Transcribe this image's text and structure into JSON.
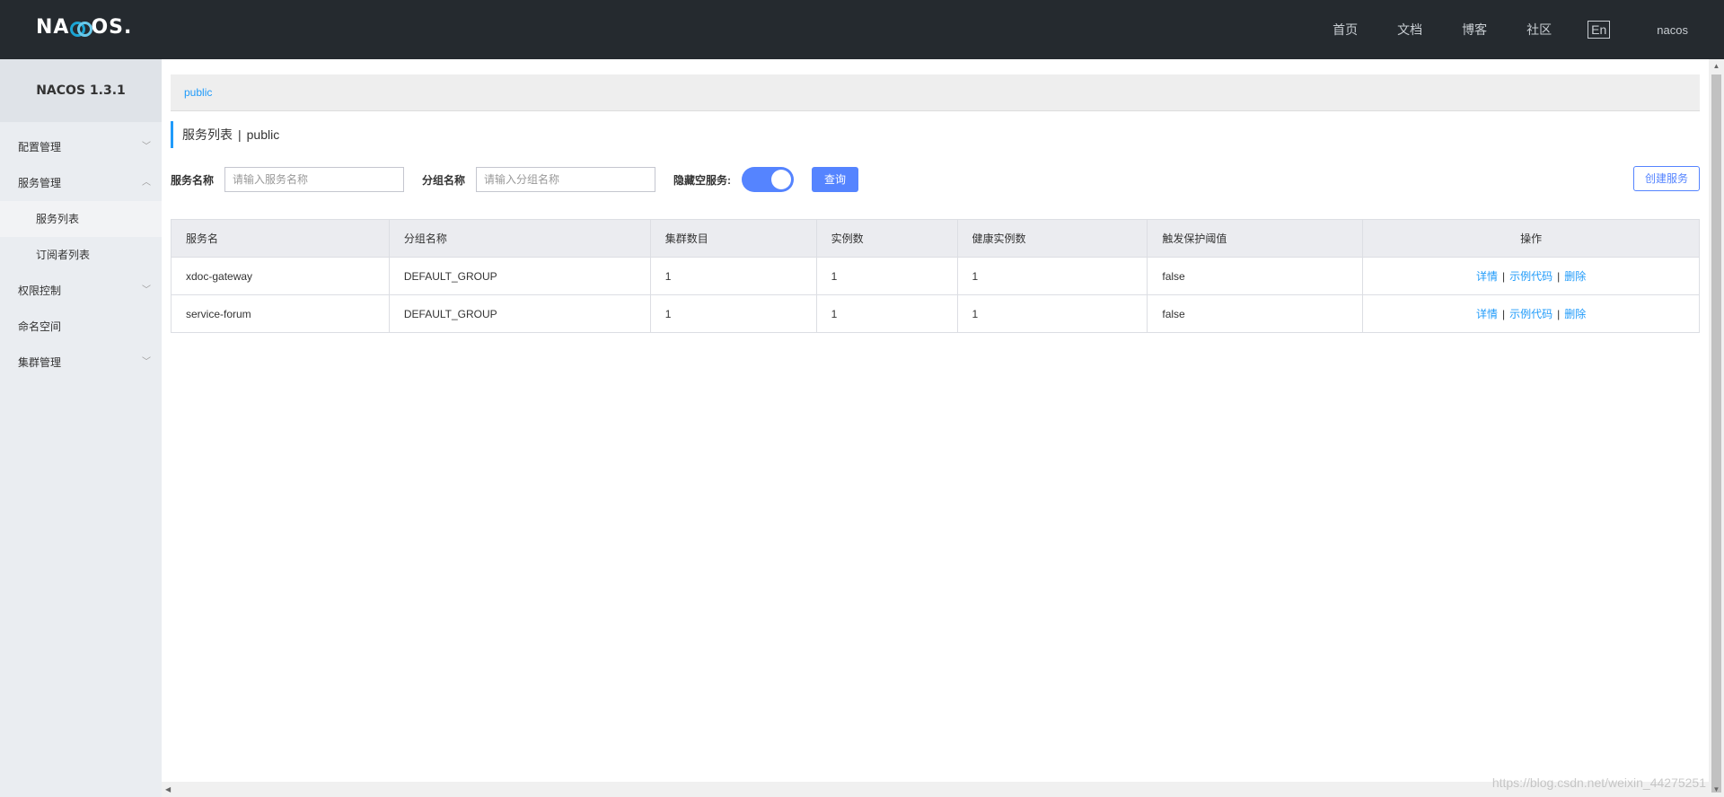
{
  "header": {
    "logo_text": "NACOS.",
    "nav": [
      "首页",
      "文档",
      "博客",
      "社区"
    ],
    "lang": "En",
    "user": "nacos"
  },
  "sidebar": {
    "version": "NACOS 1.3.1",
    "items": [
      {
        "label": "配置管理",
        "arrow": "﹀"
      },
      {
        "label": "服务管理",
        "arrow": "︿"
      },
      {
        "label": "服务列表"
      },
      {
        "label": "订阅者列表"
      },
      {
        "label": "权限控制",
        "arrow": "﹀"
      },
      {
        "label": "命名空间"
      },
      {
        "label": "集群管理",
        "arrow": "﹀"
      }
    ]
  },
  "namespace": {
    "current": "public"
  },
  "page": {
    "title": "服务列表",
    "separator": "|",
    "namespace": "public"
  },
  "filters": {
    "service_label": "服务名称",
    "service_placeholder": "请输入服务名称",
    "group_label": "分组名称",
    "group_placeholder": "请输入分组名称",
    "hide_empty_label": "隐藏空服务:",
    "hide_empty_on": true,
    "query_button": "查询",
    "create_button": "创建服务"
  },
  "table": {
    "columns": [
      "服务名",
      "分组名称",
      "集群数目",
      "实例数",
      "健康实例数",
      "触发保护阈值",
      "操作"
    ],
    "rows": [
      {
        "name": "xdoc-gateway",
        "group": "DEFAULT_GROUP",
        "clusters": "1",
        "instances": "1",
        "healthy": "1",
        "threshold": "false"
      },
      {
        "name": "service-forum",
        "group": "DEFAULT_GROUP",
        "clusters": "1",
        "instances": "1",
        "healthy": "1",
        "threshold": "false"
      }
    ],
    "ops": {
      "detail": "详情",
      "sample": "示例代码",
      "delete": "删除",
      "sep": "|"
    }
  },
  "watermark": "https://blog.csdn.net/weixin_44275251",
  "colors": {
    "header_bg": "#252a2f",
    "accent": "#5584ff",
    "link": "#209bfa",
    "sidebar_bg": "#eaedf1"
  }
}
